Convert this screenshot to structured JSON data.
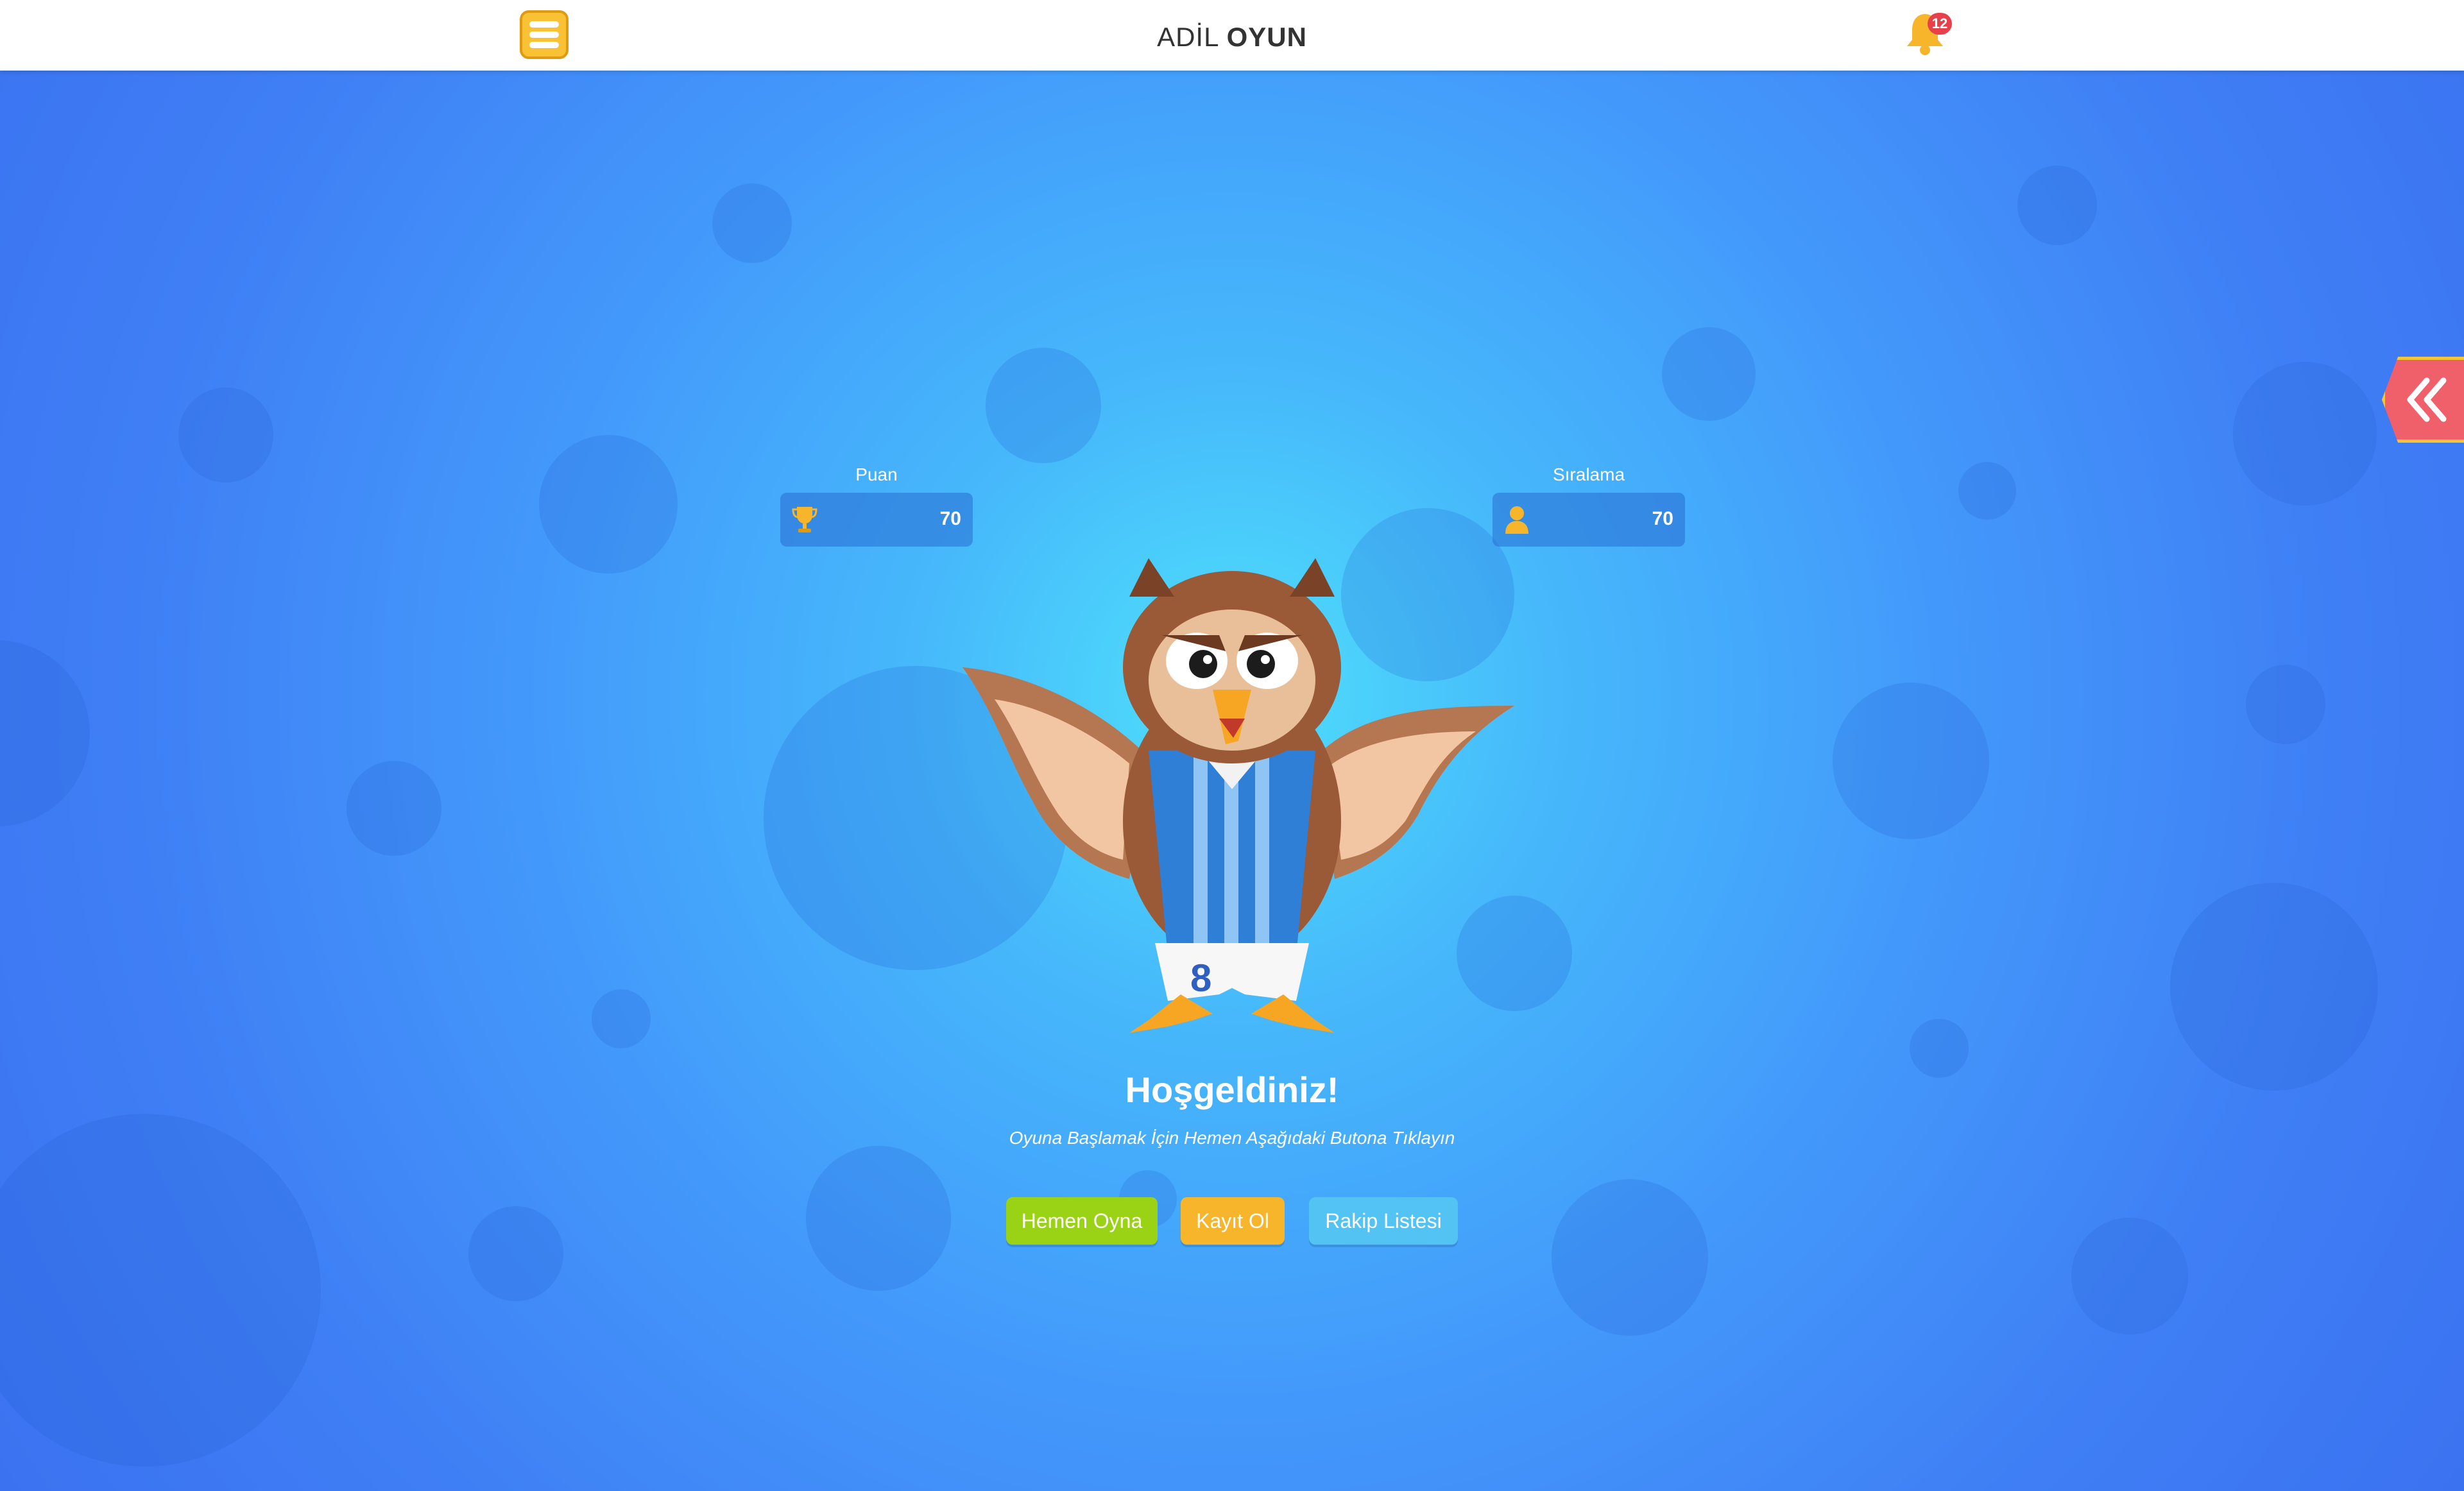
{
  "header": {
    "brand_light": "ADİL",
    "brand_bold": "OYUN",
    "notification_count": "12"
  },
  "stats": {
    "score_label": "Puan",
    "score_value": "70",
    "rank_label": "Sıralama",
    "rank_value": "70"
  },
  "hero": {
    "title": "Hoşgeldiniz!",
    "subtitle": "Oyuna Başlamak İçin Hemen Aşağıdaki Butona Tıklayın",
    "mascot_jersey_number": "8"
  },
  "buttons": {
    "play": "Hemen Oyna",
    "register": "Kayıt Ol",
    "opponents": "Rakip Listesi"
  },
  "colors": {
    "play": "#9ad316",
    "register": "#f6b52a",
    "opponents": "#52c3f3",
    "menu": "#f9c234",
    "side_tab": "#f0606a"
  },
  "icons": {
    "menu": "hamburger-icon",
    "bell": "bell-icon",
    "side_tab": "double-chevron-left-icon",
    "score": "trophy-icon",
    "rank": "user-icon"
  }
}
